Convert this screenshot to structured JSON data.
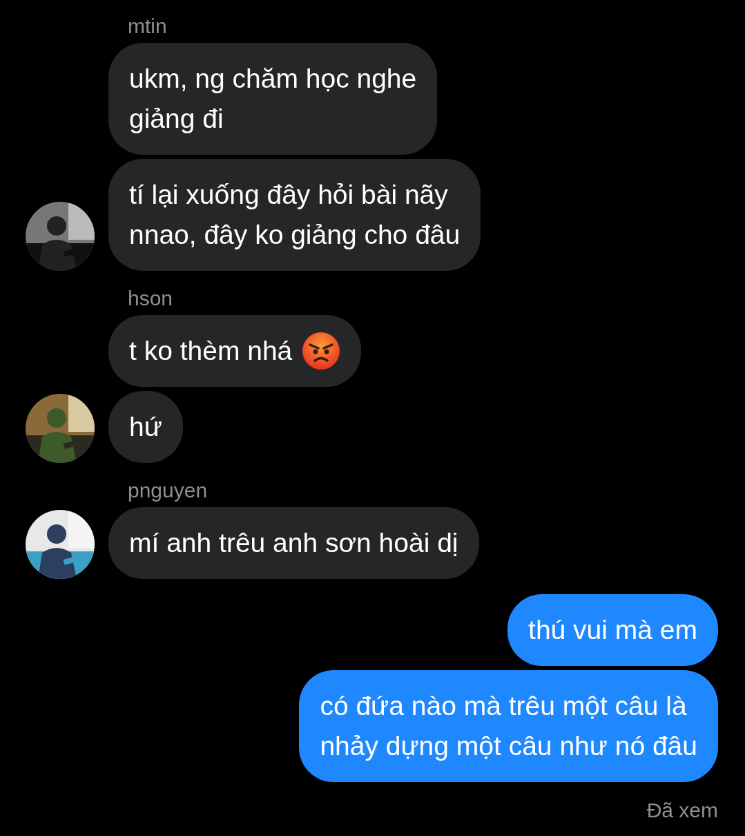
{
  "groups": [
    {
      "kind": "incoming",
      "sender": "mtin",
      "avatar": {
        "kind": "picture"
      },
      "bubbles": [
        {
          "lines": [
            "ukm, ng chăm học nghe",
            "giảng đi"
          ]
        },
        {
          "lines": [
            "tí lại xuống đây hỏi bài nãy",
            "nnao, đây ko giảng cho đâu"
          ]
        }
      ]
    },
    {
      "kind": "incoming",
      "sender": "hson",
      "avatar": {
        "kind": "picture"
      },
      "bubbles": [
        {
          "lines": [
            "t ko thèm nhá"
          ],
          "angry_emoji": true
        },
        {
          "lines": [
            "hứ"
          ]
        }
      ]
    },
    {
      "kind": "incoming",
      "sender": "pnguyen",
      "avatar": {
        "kind": "picture"
      },
      "bubbles": [
        {
          "lines": [
            "mí anh trêu anh sơn hoài dị"
          ]
        }
      ]
    },
    {
      "kind": "outgoing",
      "bubbles": [
        {
          "lines": [
            "thú vui mà em"
          ]
        },
        {
          "lines": [
            "có đứa nào mà trêu một câu là",
            "nhảy dựng một câu như nó đâu"
          ]
        }
      ]
    }
  ],
  "read_receipt": "Đã xem"
}
